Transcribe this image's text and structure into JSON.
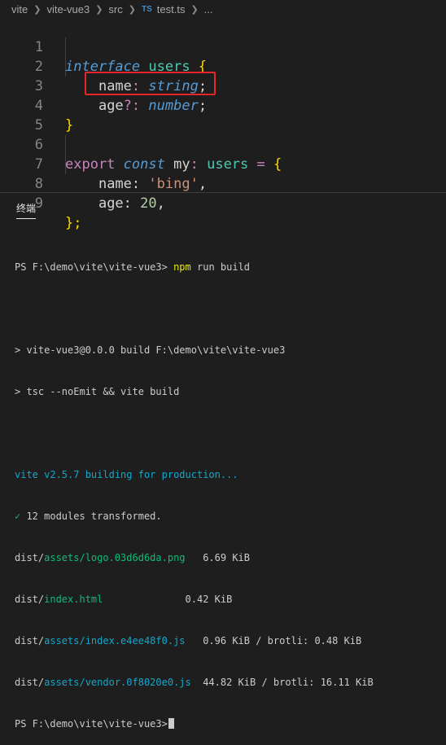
{
  "breadcrumb": {
    "items": [
      "vite",
      "vite-vue3",
      "src",
      "test.ts",
      "..."
    ],
    "ts_icon": "TS"
  },
  "editor": {
    "lines": [
      {
        "num": "1"
      },
      {
        "num": "2"
      },
      {
        "num": "3"
      },
      {
        "num": "4"
      },
      {
        "num": "5"
      },
      {
        "num": "6"
      },
      {
        "num": "7"
      },
      {
        "num": "8"
      },
      {
        "num": "9"
      }
    ],
    "tokens": {
      "interface": "interface",
      "users": "users",
      "open_brace": " {",
      "name": "name",
      "colon": ":",
      "string": "string",
      "semi": ";",
      "age": "age",
      "opt_colon": "?:",
      "number": "number",
      "close_brace": "}",
      "export": "export",
      "const": "const",
      "my": "my",
      "eq": " =",
      "str_bing": "'bing'",
      "comma": ",",
      "num_20": "20",
      "close_semi": "};"
    }
  },
  "panel": {
    "tab_label": "终端"
  },
  "terminal": {
    "lines": [
      "PS F:\\demo\\vite\\vite-vue3> ",
      "npm",
      " run build",
      "> vite-vue3@0.0.0 build F:\\demo\\vite\\vite-vue3",
      "> tsc --noEmit && vite build",
      "vite v2.5.7 building for production...",
      "✓",
      " 12 modules transformed.",
      "dist/",
      "assets/logo.03d6d6da.png",
      "   6.69 KiB",
      "dist/",
      "index.html",
      "              0.42 KiB",
      "dist/",
      "assets/index.e4ee48f0.js",
      "   0.96 KiB / brotli: 0.48 KiB",
      "dist/",
      "assets/vendor.0f8020e0.js",
      "  44.82 KiB / brotli: 16.11 KiB",
      "PS F:\\demo\\vite\\vite-vue3>"
    ]
  },
  "colors": {
    "background": "#1e1e1e",
    "keyword": "#569cd6",
    "type": "#4ec9b0",
    "string": "#ce9178",
    "number": "#b5cea8",
    "highlight_box": "#e8262a"
  }
}
